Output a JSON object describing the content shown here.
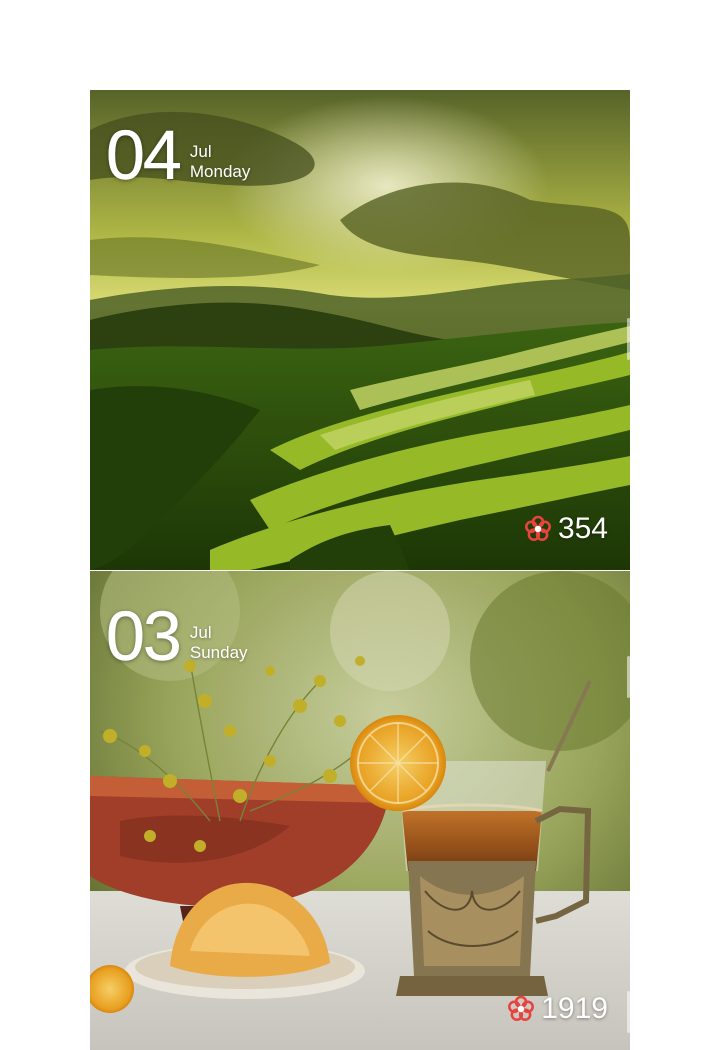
{
  "feed": {
    "cards": [
      {
        "day": "04",
        "month": "Jul",
        "weekday": "Monday",
        "likes": "354",
        "like_icon": "flower-icon",
        "scene": "rice-terraces-sunset"
      },
      {
        "day": "03",
        "month": "Jul",
        "weekday": "Sunday",
        "likes": "1919",
        "like_icon": "flower-icon",
        "scene": "tea-glass-still-life"
      }
    ]
  },
  "colors": {
    "like_icon": "#e8433f",
    "overlay_text": "#ffffff",
    "background": "#ffffff"
  }
}
